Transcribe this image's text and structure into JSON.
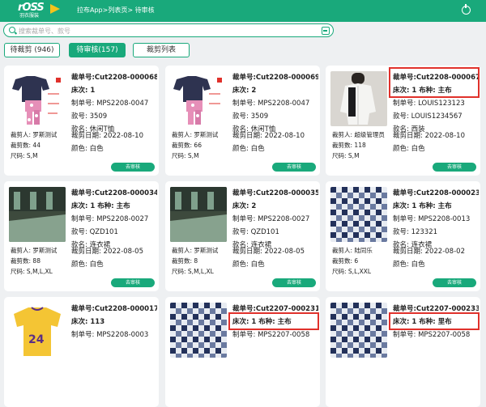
{
  "header": {
    "logo_text": "rOSS",
    "logo_sub": "羽衣服装",
    "breadcrumb": "拉布App>列表页> 待审核"
  },
  "search": {
    "placeholder": "搜索裁单号、款号"
  },
  "tabs": [
    {
      "label": "待裁剪 (946)"
    },
    {
      "label": "待审核(157)"
    },
    {
      "label": "裁剪列表"
    }
  ],
  "labels": {
    "cut_no": "裁单号:",
    "bed": "床次:",
    "order": "制单号:",
    "style_no": "款号:",
    "style_name": "款名:",
    "cutter": "裁剪人:",
    "qty": "裁剪数:",
    "size": "尺码:",
    "date": "裁剪日期:",
    "color": "颜色:",
    "fabric": "布种:"
  },
  "action_label": "去审核",
  "cards": [
    {
      "cut_no": "Cut2208-000068",
      "bed": "1",
      "order": "MPS2208-0047",
      "style_no": "3509",
      "style_name": "休闲T恤",
      "cutter": "罗斯测试",
      "qty": "44",
      "size": "S,M",
      "date": "2022-08-10",
      "color": "白色"
    },
    {
      "cut_no": "Cut2208-000069",
      "bed": "2",
      "order": "MPS2208-0047",
      "style_no": "3509",
      "style_name": "休闲T恤",
      "cutter": "罗斯测试",
      "qty": "66",
      "size": "S,M",
      "date": "2022-08-10",
      "color": "白色"
    },
    {
      "cut_no": "Cut2208-000067",
      "bed": "1",
      "fabric": "主布",
      "order": "LOUIS123123",
      "style_no": "LOUIS1234567",
      "style_name": "西装",
      "cutter": "超级管理员",
      "qty": "118",
      "size": "S,M",
      "date": "2022-08-10",
      "color": "白色"
    },
    {
      "cut_no": "Cut2208-000034",
      "bed": "1",
      "fabric": "主布",
      "order": "MPS2208-0027",
      "style_no": "QZD101",
      "style_name": "连衣裙",
      "cutter": "罗斯测试",
      "qty": "88",
      "size": "S,M,L,XL",
      "date": "2022-08-05",
      "color": "白色"
    },
    {
      "cut_no": "Cut2208-000035",
      "bed": "2",
      "order": "MPS2208-0027",
      "style_no": "QZD101",
      "style_name": "连衣裙",
      "cutter": "罗斯测试",
      "qty": "8",
      "size": "S,M,L,XL",
      "date": "2022-08-05",
      "color": "白色"
    },
    {
      "cut_no": "Cut2208-000023",
      "bed": "1",
      "fabric": "主布",
      "order": "MPS2208-0013",
      "style_no": "123321",
      "style_name": "连衣裙",
      "cutter": "陆同乐",
      "qty": "6",
      "size": "S,L,XXL",
      "date": "2022-08-02",
      "color": "白色"
    },
    {
      "cut_no": "Cut2208-000017",
      "bed": "113",
      "order": "MPS2208-0003"
    },
    {
      "cut_no": "Cut2207-000231",
      "bed": "1",
      "fabric": "主布",
      "order": "MPS2207-0058"
    },
    {
      "cut_no": "Cut2207-000233",
      "bed": "1",
      "fabric": "里布",
      "order": "MPS2207-0058"
    }
  ],
  "colors": {
    "brand": "#19a97b",
    "highlight": "#e0312b"
  }
}
